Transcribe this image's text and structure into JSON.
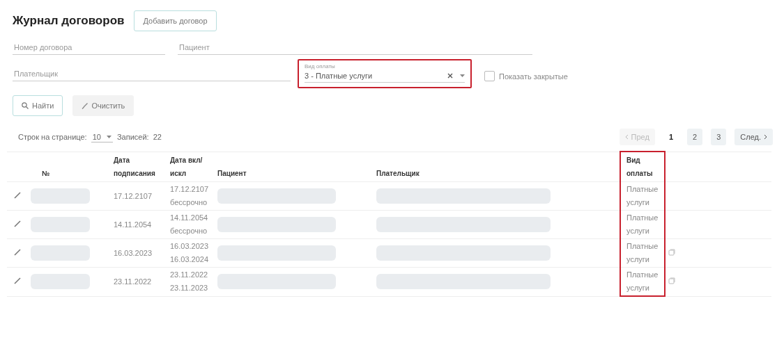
{
  "header": {
    "title": "Журнал договоров",
    "add_button": "Добавить договор"
  },
  "filters": {
    "contract_number": {
      "placeholder": "Номер договора"
    },
    "patient": {
      "placeholder": "Пациент"
    },
    "payer": {
      "placeholder": "Плательщик"
    },
    "payment_type": {
      "label": "Вид оплаты",
      "value": "3 - Платные услуги",
      "highlighted": true
    },
    "show_closed": {
      "label": "Показать закрытые",
      "checked": false
    }
  },
  "actions": {
    "search": "Найти",
    "clear": "Очистить"
  },
  "pagination": {
    "rows_label": "Строк на странице:",
    "rows_value": "10",
    "records_label": "Записей:",
    "records_count": "22",
    "prev": {
      "label": "Пред",
      "disabled": true
    },
    "pages": [
      {
        "label": "1",
        "selected": true
      },
      {
        "label": "2",
        "selected": false
      },
      {
        "label": "3",
        "selected": false
      }
    ],
    "next": {
      "label": "След.",
      "disabled": false
    }
  },
  "table": {
    "columns": [
      {
        "label": "№",
        "highlighted": false
      },
      {
        "label": "Дата подписания",
        "highlighted": false
      },
      {
        "label": "Дата вкл/ искл",
        "highlighted": false
      },
      {
        "label": "Пациент",
        "highlighted": false
      },
      {
        "label": "Плательщик",
        "highlighted": false
      },
      {
        "label": "Вид оплаты",
        "highlighted": true
      }
    ],
    "rows": [
      {
        "signed": "17.12.2107",
        "start": "17.12.2107",
        "end": "бессрочно",
        "payment": "Платные услуги",
        "action_icon": false
      },
      {
        "signed": "14.11.2054",
        "start": "14.11.2054",
        "end": "бессрочно",
        "payment": "Платные услуги",
        "action_icon": false
      },
      {
        "signed": "16.03.2023",
        "start": "16.03.2023",
        "end": "16.03.2024",
        "payment": "Платные услуги",
        "action_icon": true
      },
      {
        "signed": "23.11.2022",
        "start": "23.11.2022",
        "end": "23.11.2023",
        "payment": "Платные услуги",
        "action_icon": true
      }
    ]
  }
}
